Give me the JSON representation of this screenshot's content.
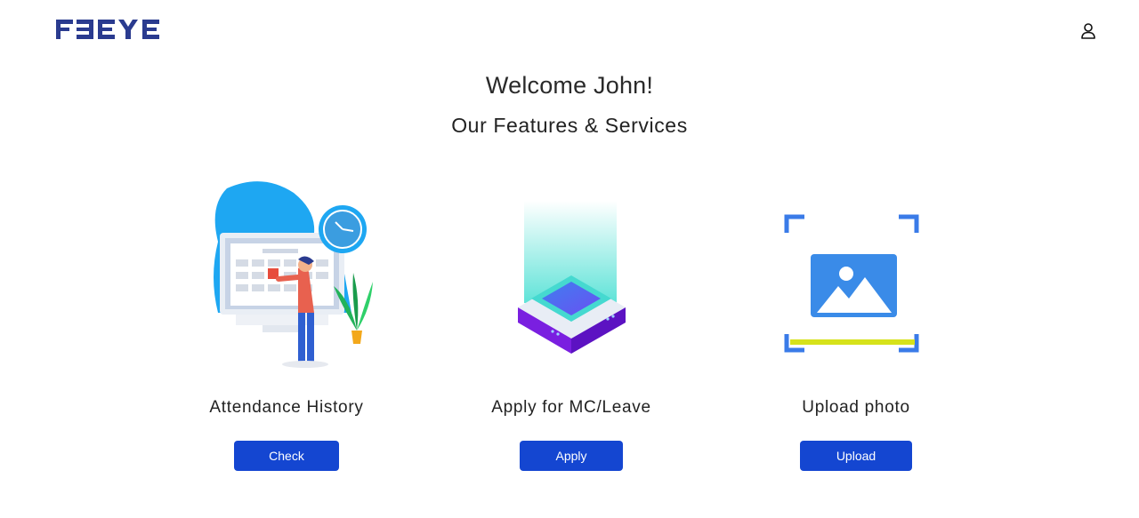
{
  "header": {
    "logo_text": "FBEYE",
    "user_icon": "user-icon"
  },
  "main": {
    "welcome": "Welcome John!",
    "subtitle": "Our Features & Services",
    "features": [
      {
        "title": "Attendance History",
        "button_label": "Check",
        "icon": "attendance-illustration"
      },
      {
        "title": "Apply for MC/Leave",
        "button_label": "Apply",
        "icon": "leave-illustration"
      },
      {
        "title": "Upload photo",
        "button_label": "Upload",
        "icon": "photo-upload-illustration"
      }
    ]
  },
  "colors": {
    "brand": "#2a3b8f",
    "button": "#1446d1",
    "accent_blue": "#1ea7f2",
    "accent_purple": "#7a1fe0",
    "accent_yellow": "#d6e21b"
  }
}
